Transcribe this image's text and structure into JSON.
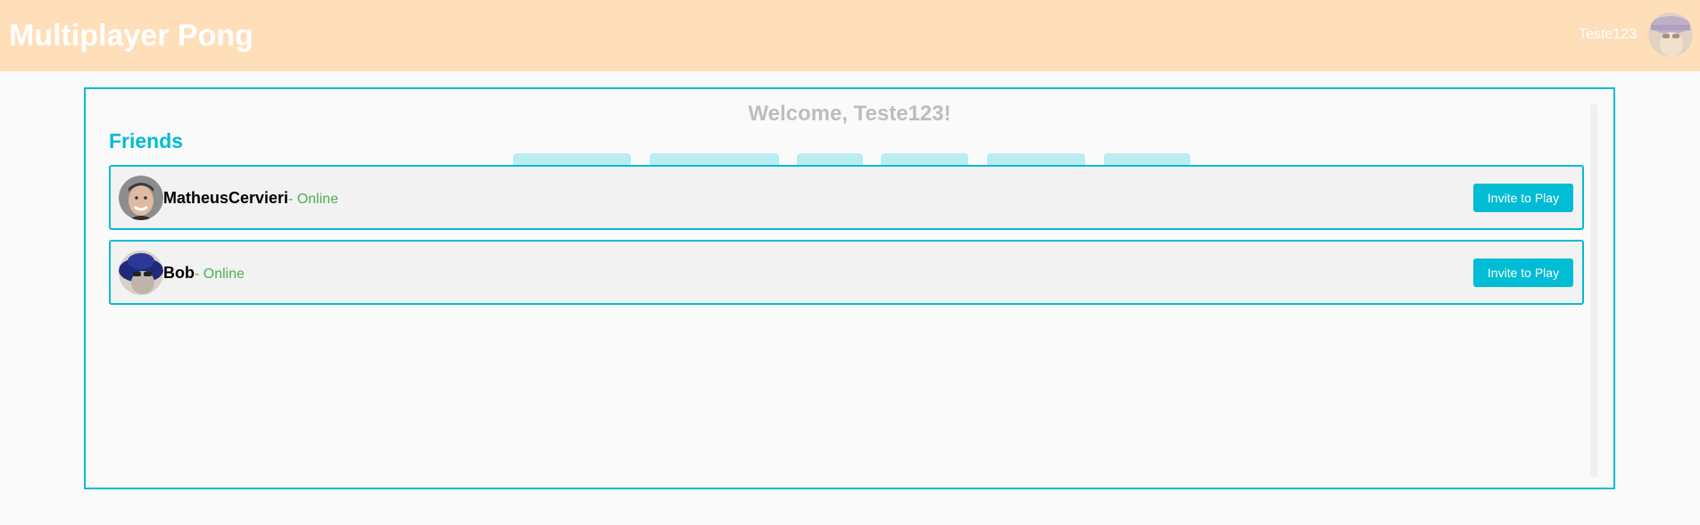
{
  "header": {
    "app_title": "Multiplayer Pong",
    "username": "Teste123",
    "avatar_icon": "user-avatar-icon",
    "background_color": "#ffdfba"
  },
  "main": {
    "welcome_text": "Welcome, Teste123!",
    "friends_title": "Friends",
    "accent_color": "#00bcd4",
    "friends": [
      {
        "name": "MatheusCervieri",
        "status": "- Online",
        "avatar_icon": "friend-avatar-icon",
        "action_label": "Invite to Play"
      },
      {
        "name": "Bob",
        "status": "- Online",
        "avatar_icon": "friend-avatar-icon",
        "action_label": "Invite to Play"
      }
    ],
    "status_color": "#4caf50"
  }
}
